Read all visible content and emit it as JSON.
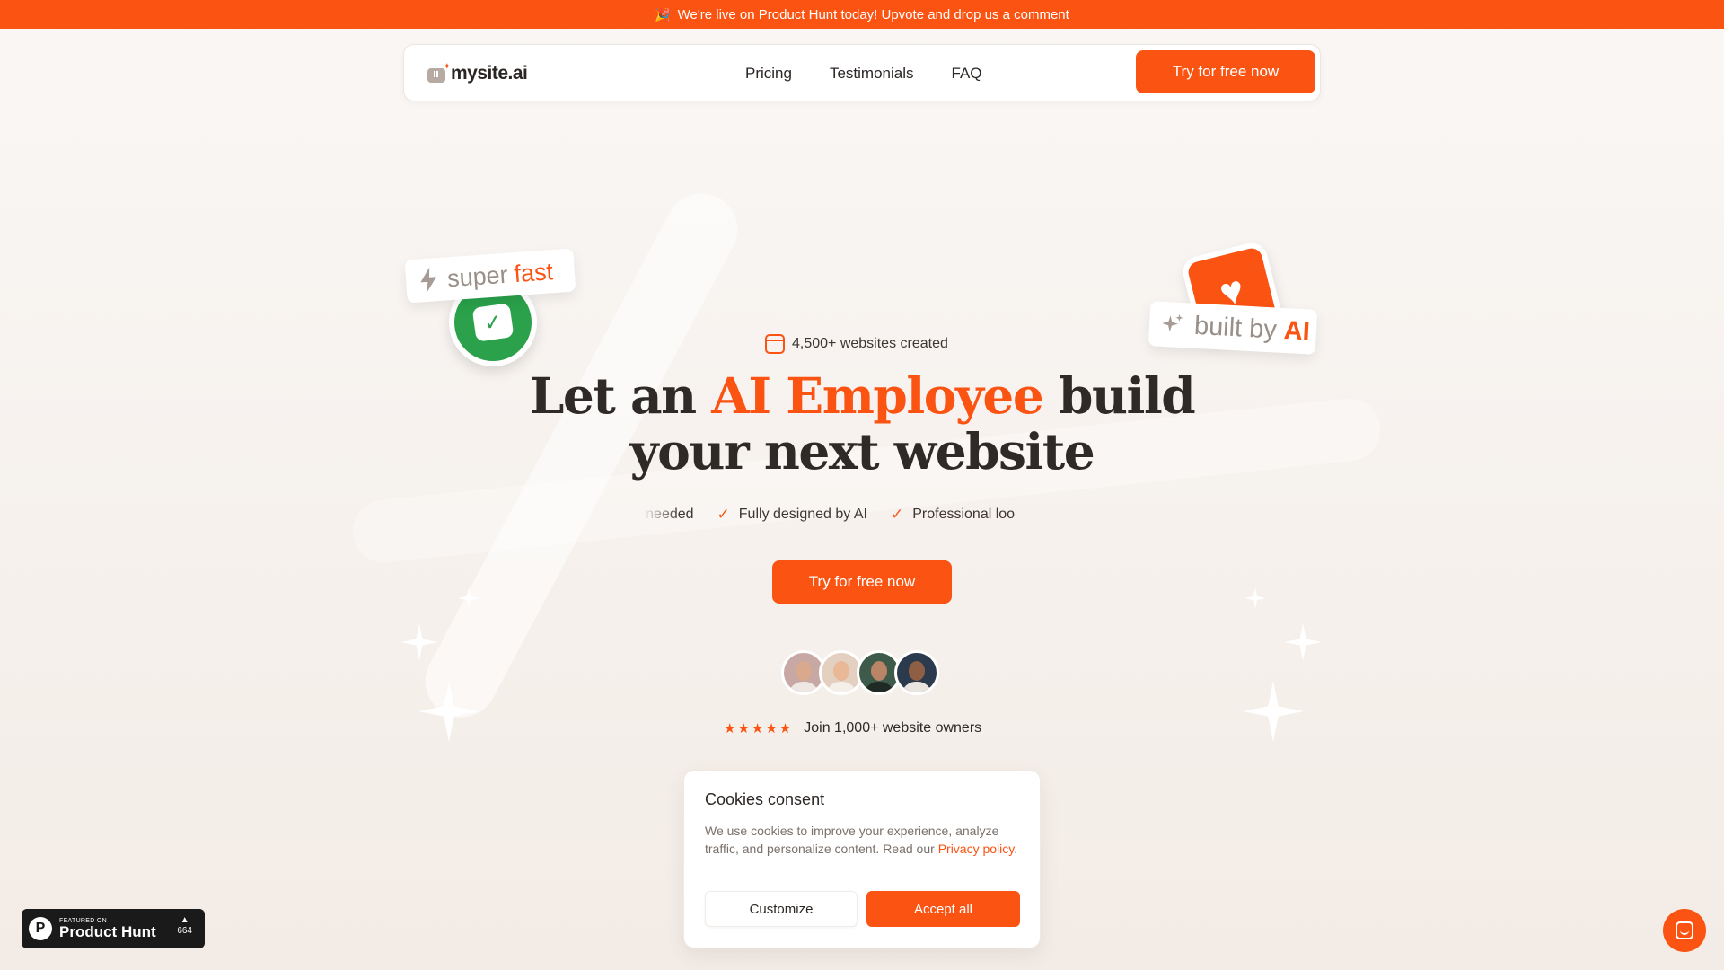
{
  "announcement": {
    "emoji": "🎉",
    "text": "We're live on Product Hunt today! Upvote and drop us a comment"
  },
  "nav": {
    "logo_text": "mysite.ai",
    "links": [
      "Pricing",
      "Testimonials",
      "FAQ"
    ],
    "cta": "Try for free now"
  },
  "badges": {
    "fast_word1": "super",
    "fast_word2": "fast",
    "ai_word1": "built by",
    "ai_word2": "AI"
  },
  "hero": {
    "stat": "4,500+ websites created",
    "headline_part1": "Let an ",
    "headline_accent": "AI Employee",
    "headline_part2": " build your next website",
    "features": [
      "ence needed",
      "Fully designed by AI",
      "Professional loo"
    ],
    "cta": "Try for free now",
    "stars": "★★★★★",
    "social_proof": "Join 1,000+ website owners"
  },
  "cookie": {
    "title": "Cookies consent",
    "body": "We use cookies to improve your experience, analyze traffic, and personalize content. Read our ",
    "link": "Privacy policy",
    "end": ".",
    "customize": "Customize",
    "accept": "Accept all"
  },
  "product_hunt": {
    "featured": "FEATURED ON",
    "name": "Product Hunt",
    "votes": "664"
  },
  "colors": {
    "accent": "#fa5312",
    "green": "#2aa14a",
    "background": "#f7f2ee"
  },
  "icons": [
    "lightning-icon",
    "check-icon",
    "heart-icon",
    "sparkle-icon",
    "calendar-icon",
    "star-icon",
    "chat-icon"
  ]
}
